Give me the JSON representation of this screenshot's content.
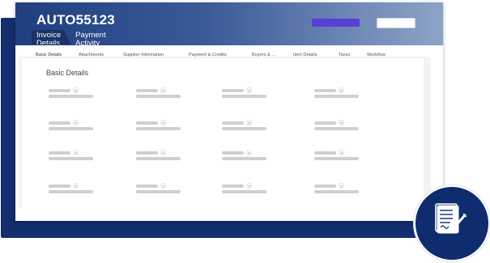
{
  "header": {
    "title": "AUTO55123",
    "tabs": [
      {
        "label": "Invoice\nDetails",
        "active": true
      },
      {
        "label": "Payment\nActivity",
        "active": false
      }
    ]
  },
  "actions": {
    "primary_color": "#5a3fd6",
    "secondary_color": "#ffffff"
  },
  "tabs": [
    {
      "label": "Basic Details",
      "active": true
    },
    {
      "label": "Attachments"
    },
    {
      "label": "Supplier Information"
    },
    {
      "label": "Payment & Credits"
    },
    {
      "label": "Buyers & ..."
    },
    {
      "label": "Item Details"
    },
    {
      "label": "Taxes"
    },
    {
      "label": "Workflow"
    }
  ],
  "section": {
    "title": "Basic Details"
  },
  "colors": {
    "header_dark": "#1f3f80",
    "header_light": "#8ea4c7",
    "active_tab_underline": "#d7262c",
    "field_icon": "#e86a1e",
    "badge": "#0f2c6e"
  },
  "icons": {
    "field_icon": "play-icon",
    "badge_icon": "document-edit-icon"
  }
}
